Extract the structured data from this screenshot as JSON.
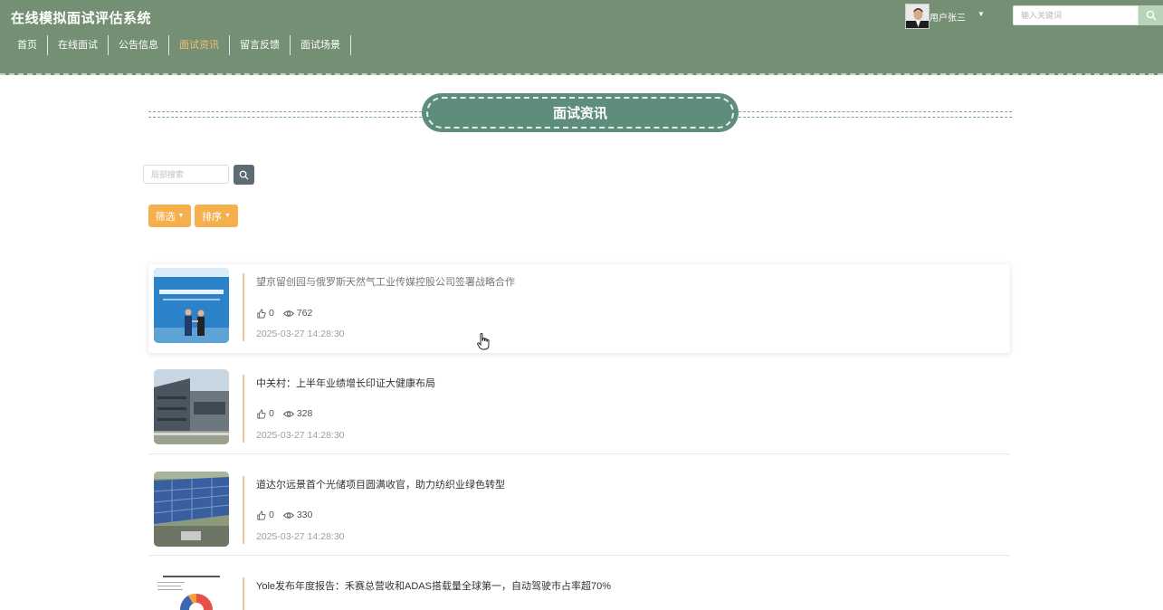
{
  "header": {
    "site_title": "在线模拟面试评估系统",
    "nav": [
      {
        "label": "首页",
        "active": false
      },
      {
        "label": "在线面试",
        "active": false
      },
      {
        "label": "公告信息",
        "active": false
      },
      {
        "label": "面试资讯",
        "active": true
      },
      {
        "label": "留言反馈",
        "active": false
      },
      {
        "label": "面试场景",
        "active": false
      }
    ],
    "user_name": "用户张三",
    "search_placeholder": "输入关键词",
    "nav_active_color": "#f3c173",
    "background_color": "#748f74"
  },
  "section": {
    "title": "面试资讯",
    "accent_color": "#5e8e7b"
  },
  "toolbar": {
    "local_search_placeholder": "局部搜索",
    "filter_label": "筛选",
    "sort_label": "排序",
    "button_color": "#f5b04d"
  },
  "news": [
    {
      "title": "望京留创园与俄罗斯天然气工业传媒控股公司签署战略合作",
      "likes": "0",
      "views": "762",
      "date": "2025-03-27 14:28:30",
      "image": "signing-ceremony"
    },
    {
      "title": "中关村：上半年业绩增长印证大健康布局",
      "likes": "0",
      "views": "328",
      "date": "2025-03-27 14:28:30",
      "image": "office-building"
    },
    {
      "title": "道达尔远景首个光储项目圆满收官，助力纺织业绿色转型",
      "likes": "0",
      "views": "330",
      "date": "2025-03-27 14:28:30",
      "image": "solar-panels"
    },
    {
      "title": "Yole发布年度报告：禾赛总营收和ADAS搭载量全球第一，自动驾驶市占率超70%",
      "likes": "",
      "views": "",
      "date": "",
      "image": "market-share-chart"
    }
  ],
  "icons": {
    "like": "thumbs-up-icon",
    "views": "eye-icon",
    "search": "search-icon"
  }
}
